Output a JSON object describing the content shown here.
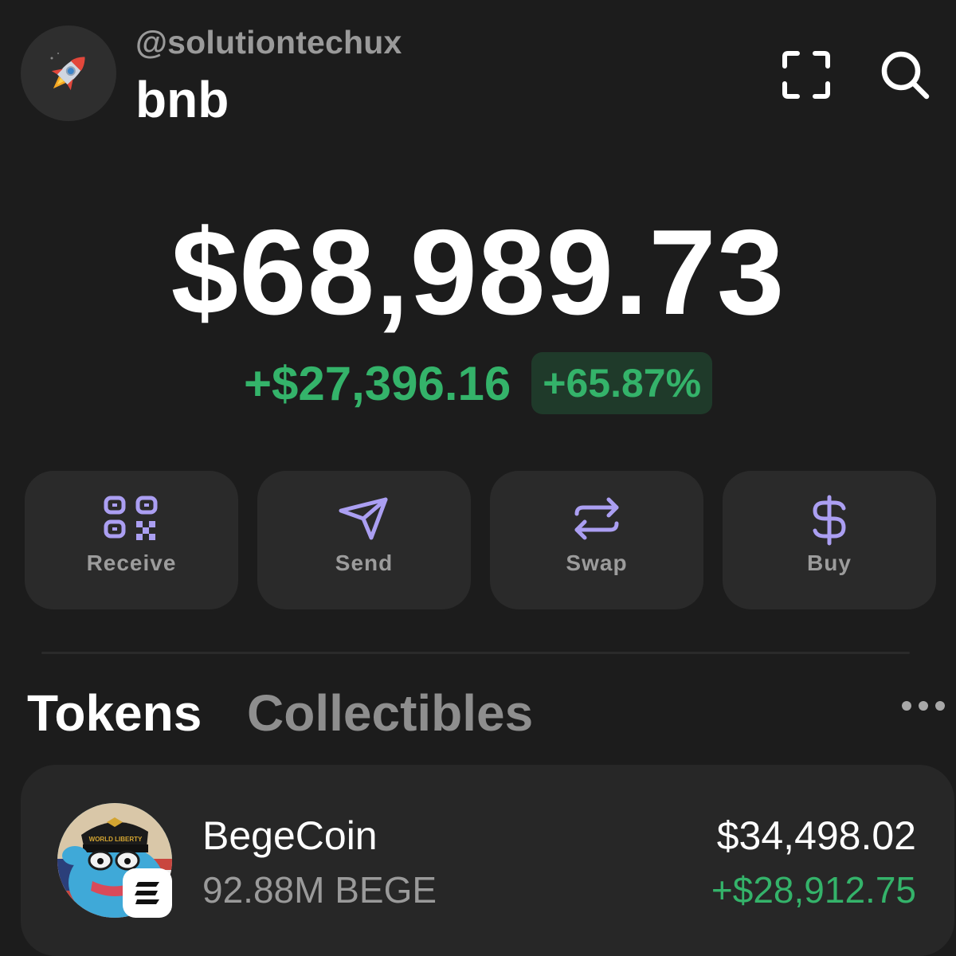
{
  "header": {
    "handle": "@solutiontechux",
    "account_name": "bnb",
    "avatar_icon": "rocket-icon",
    "scan_icon": "scan-icon",
    "search_icon": "search-icon"
  },
  "balance": {
    "total": "$68,989.73",
    "change_amount": "+$27,396.16",
    "change_percent": "+65.87%"
  },
  "actions": [
    {
      "label": "Receive",
      "icon": "qr-code-icon"
    },
    {
      "label": "Send",
      "icon": "send-icon"
    },
    {
      "label": "Swap",
      "icon": "swap-icon"
    },
    {
      "label": "Buy",
      "icon": "dollar-icon"
    }
  ],
  "tabs": {
    "tokens": "Tokens",
    "collectibles": "Collectibles",
    "more_icon": "more-icon"
  },
  "tokens": [
    {
      "name": "BegeCoin",
      "amount": "92.88M BEGE",
      "value": "$34,498.02",
      "change": "+$28,912.75",
      "logo_badge_text": "WORLD LIBERTY"
    }
  ],
  "colors": {
    "background": "#1c1c1c",
    "card": "#2a2a2a",
    "accent_purple": "#ab9ff2",
    "positive_green": "#34b36a",
    "positive_green_bg": "#1f3a2a",
    "muted_text": "#9a9a9a"
  }
}
